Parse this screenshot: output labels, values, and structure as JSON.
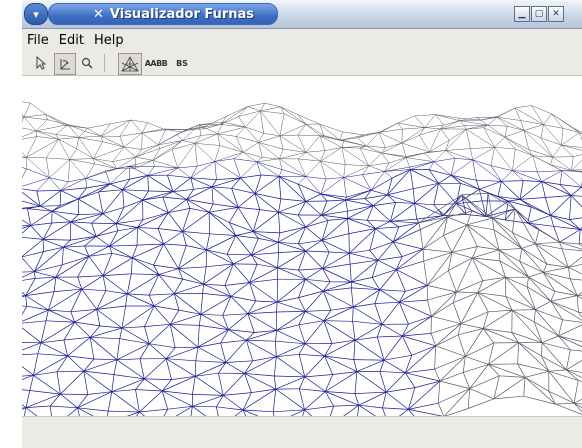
{
  "window": {
    "title": "Visualizador Furnas",
    "app_icon": "x-glyph-icon",
    "controls": [
      "minimize",
      "maximize",
      "close"
    ]
  },
  "menubar": {
    "items": [
      {
        "label": "File"
      },
      {
        "label": "Edit"
      },
      {
        "label": "Help"
      }
    ]
  },
  "toolbar": {
    "tools": [
      {
        "name": "pointer-tool",
        "icon": "cursor-icon",
        "pressed": false
      },
      {
        "name": "rotate-tool",
        "icon": "rotate-axes-icon",
        "pressed": true
      },
      {
        "name": "zoom-tool",
        "icon": "magnifier-icon",
        "pressed": false
      },
      {
        "name": "mesh-tool",
        "icon": "mesh-wireframe-icon",
        "pressed": true
      },
      {
        "name": "aabb-tool",
        "label": "AABB",
        "pressed": false
      },
      {
        "name": "bs-tool",
        "label": "BS",
        "pressed": false
      }
    ]
  },
  "viewport": {
    "content": "3d-terrain-wireframe",
    "colors": {
      "near": "#1a1a9c",
      "far": "#5a5a6a",
      "background": "#ffffff"
    }
  }
}
